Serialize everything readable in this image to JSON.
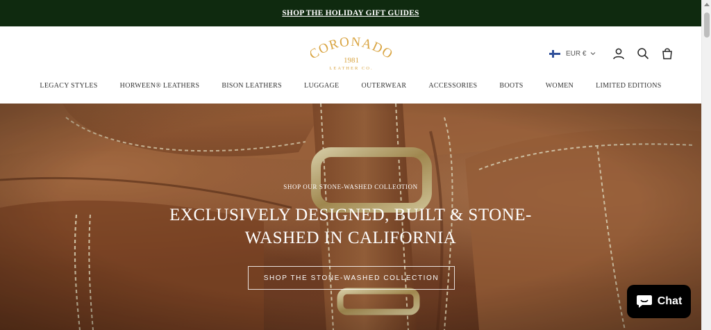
{
  "announcement": {
    "text": "SHOP THE HOLIDAY GIFT GUIDES"
  },
  "brand": {
    "name": "CORONADO",
    "year": "1981",
    "tagline": "LEATHER CO.",
    "color": "#d9a441"
  },
  "header": {
    "currency": "EUR €",
    "flag": "finland-flag",
    "icons": [
      "account-icon",
      "search-icon",
      "cart-icon"
    ]
  },
  "nav": {
    "items": [
      "LEGACY STYLES",
      "HORWEEN® LEATHERS",
      "BISON LEATHERS",
      "LUGGAGE",
      "OUTERWEAR",
      "ACCESSORIES",
      "BOOTS",
      "WOMEN",
      "LIMITED EDITIONS"
    ]
  },
  "hero": {
    "kicker": "SHOP OUR STONE-WASHED COLLECTION",
    "title": "EXCLUSIVELY DESIGNED, BUILT & STONE-WASHED IN CALIFORNIA",
    "button": "SHOP THE STONE-WASHED COLLECTION"
  },
  "chat": {
    "label": "Chat"
  },
  "colors": {
    "announcement_bg": "#0f2a0f",
    "leather": "#9a5d36",
    "gold": "#d9a441",
    "chat_bg": "#000000"
  }
}
